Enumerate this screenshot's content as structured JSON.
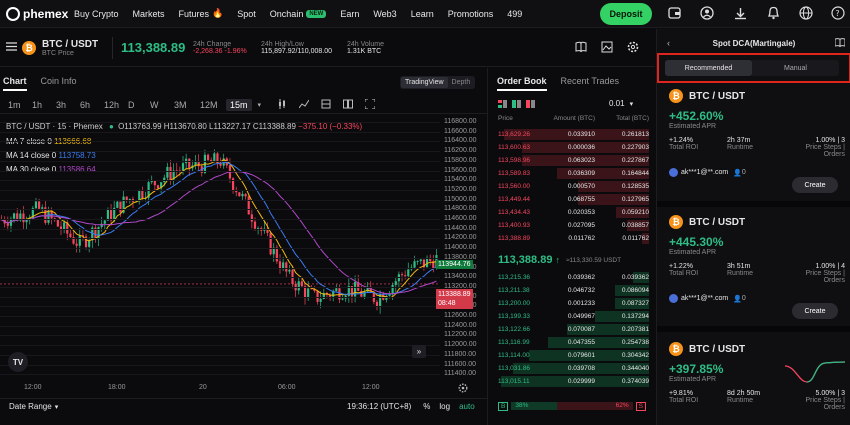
{
  "topnav": {
    "brand": "phemex",
    "items": [
      "Buy Crypto",
      "Markets",
      "Futures",
      "Spot",
      "Onchain",
      "Earn",
      "Web3",
      "Learn",
      "Promotions",
      "499"
    ],
    "new_badge": "NEW",
    "deposit": "Deposit"
  },
  "ticker": {
    "pair": "BTC / USDT",
    "sub": "BTC Price",
    "price": "113,388.89",
    "change_label": "24h Change",
    "change": "-2,268.36 -1.96%",
    "hl_label": "24h High/Low",
    "hl": "115,897.92/110,008.00",
    "vol_label": "24h Volume",
    "vol": "1.31K BTC"
  },
  "chart_tabs": {
    "chart": "Chart",
    "coininfo": "Coin Info",
    "tradingview": "TradingView",
    "depth": "Depth"
  },
  "intervals": [
    "1m",
    "1h",
    "3h",
    "6h",
    "12h",
    "D",
    "W",
    "3M",
    "12M",
    "15m"
  ],
  "legend": {
    "title": "BTC / USDT · 15 · Phemex",
    "o": "O113763.99",
    "h": "H113670.80",
    "l": "L113227.17",
    "c": "C113388.89",
    "chg": "−375.10 (−0.33%)",
    "ma7": "MA 7 close 0",
    "ma7v": "113666.68",
    "ma14": "MA 14 close 0",
    "ma14v": "113758.73",
    "ma30": "MA 30 close 0",
    "ma30v": "113586.64"
  },
  "colors": {
    "accent": "#34d164",
    "up": "#2ebd85",
    "down": "#f6465d",
    "ma7": "#f0b90b",
    "ma14": "#3b7bf0",
    "ma30": "#b048c8"
  },
  "price_axis": [
    "116800.00",
    "116600.00",
    "116400.00",
    "116200.00",
    "115800.00",
    "115600.00",
    "115400.00",
    "115200.00",
    "115000.00",
    "114800.00",
    "114600.00",
    "114400.00",
    "114200.00",
    "114000.00",
    "113800.00",
    "113600.00",
    "113400.00",
    "113200.00",
    "113000.00",
    "112800.00",
    "112600.00",
    "112400.00",
    "112200.00",
    "112000.00",
    "111800.00",
    "111600.00",
    "111400.00"
  ],
  "time_axis": [
    "12:00",
    "18:00",
    "20",
    "06:00",
    "12:00"
  ],
  "price_tags": {
    "ma": "113944.76",
    "last": "113388.89",
    "countdown": "08:48"
  },
  "chart_footer": {
    "range": "Date Range",
    "time": "19:36:12 (UTC+8)",
    "pct": "%",
    "log": "log",
    "auto": "auto"
  },
  "orderbook": {
    "tab1": "Order Book",
    "tab2": "Recent Trades",
    "precision": "0.01",
    "h_price": "Price",
    "h_amount": "Amount (BTC)",
    "h_total": "Total (BTC)",
    "asks": [
      [
        "113,629.26",
        "0.033910",
        "0.261813"
      ],
      [
        "113,600.63",
        "0.000036",
        "0.227903"
      ],
      [
        "113,598.96",
        "0.063023",
        "0.227867"
      ],
      [
        "113,589.83",
        "0.036309",
        "0.164844"
      ],
      [
        "113,560.00",
        "0.000570",
        "0.128535"
      ],
      [
        "113,449.44",
        "0.068755",
        "0.127965"
      ],
      [
        "113,434.43",
        "0.020353",
        "0.059210"
      ],
      [
        "113,400.93",
        "0.027095",
        "0.038857"
      ],
      [
        "113,388.89",
        "0.011762",
        "0.011762"
      ]
    ],
    "mid": "113,388.89",
    "mid_sub": "≈113,330.59 USDT",
    "bids": [
      [
        "113,215.36",
        "0.039362",
        "0.039362"
      ],
      [
        "113,211.38",
        "0.046732",
        "0.086094"
      ],
      [
        "113,200.00",
        "0.001233",
        "0.087327"
      ],
      [
        "113,199.33",
        "0.049967",
        "0.137294"
      ],
      [
        "113,122.66",
        "0.070087",
        "0.207381"
      ],
      [
        "113,116.99",
        "0.047355",
        "0.254738"
      ],
      [
        "113,114.00",
        "0.079601",
        "0.304342"
      ],
      [
        "113,031.86",
        "0.039708",
        "0.344040"
      ],
      [
        "113,015.11",
        "0.029999",
        "0.374039"
      ]
    ],
    "buy_label": "B",
    "buy_pct": "38%",
    "sell_pct": "62%",
    "sell_label": "S",
    "buy_fraction": 0.38
  },
  "dca": {
    "title": "Spot DCA(Martingale)",
    "tab_rec": "Recommended",
    "tab_manual": "Manual",
    "cards": [
      {
        "pair": "BTC / USDT",
        "apr": "+452.60%",
        "apr_label": "Estimated APR",
        "roi": "+1.24%",
        "roi_label": "Total ROI",
        "runtime": "2h 37m",
        "runtime_label": "Runtime",
        "steps": "1.00% | 3",
        "steps_label": "Price Steps | Orders",
        "user": "ak***1@**.com",
        "count": "0",
        "create": "Create"
      },
      {
        "pair": "BTC / USDT",
        "apr": "+445.30%",
        "apr_label": "Estimated APR",
        "roi": "+1.22%",
        "roi_label": "Total ROI",
        "runtime": "3h 51m",
        "runtime_label": "Runtime",
        "steps": "1.00% | 4",
        "steps_label": "Price Steps | Orders",
        "user": "ak***1@**.com",
        "count": "0",
        "create": "Create"
      },
      {
        "pair": "BTC / USDT",
        "apr": "+397.85%",
        "apr_label": "Estimated APR",
        "roi": "+9.81%",
        "roi_label": "Total ROI",
        "runtime": "8d 2h 50m",
        "runtime_label": "Runtime",
        "steps": "5.00% | 3",
        "steps_label": "Price Steps | Orders"
      }
    ]
  }
}
